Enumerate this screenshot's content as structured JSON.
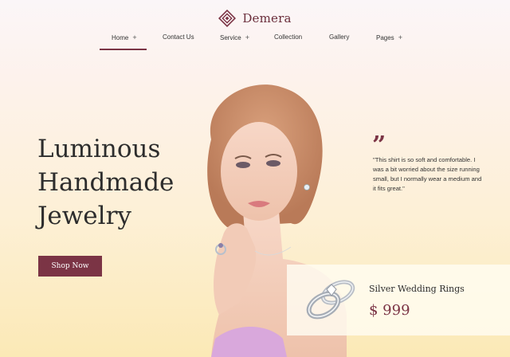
{
  "brand": {
    "name": "Demera",
    "logo_icon": "diamond-logo-icon",
    "accent_color": "#7b3445"
  },
  "nav": {
    "items": [
      {
        "label": "Home",
        "has_submenu": true,
        "active": true
      },
      {
        "label": "Contact Us",
        "has_submenu": false,
        "active": false
      },
      {
        "label": "Service",
        "has_submenu": true,
        "active": false
      },
      {
        "label": "Collection",
        "has_submenu": false,
        "active": false
      },
      {
        "label": "Gallery",
        "has_submenu": false,
        "active": false
      },
      {
        "label": "Pages",
        "has_submenu": true,
        "active": false
      }
    ],
    "submenu_indicator": "+"
  },
  "hero": {
    "headline_lines": [
      "Luminous",
      "Handmade",
      "Jewelry"
    ],
    "cta_label": "Shop Now"
  },
  "testimonial": {
    "quote_glyph": "”",
    "text": "\"This shirt is so soft and comfortable. I was a bit worried about the size running small, but I normally wear a medium and it fits great.\""
  },
  "product": {
    "name": "Silver Wedding Rings",
    "price": "$ 999",
    "image_icon": "wedding-rings-icon"
  }
}
